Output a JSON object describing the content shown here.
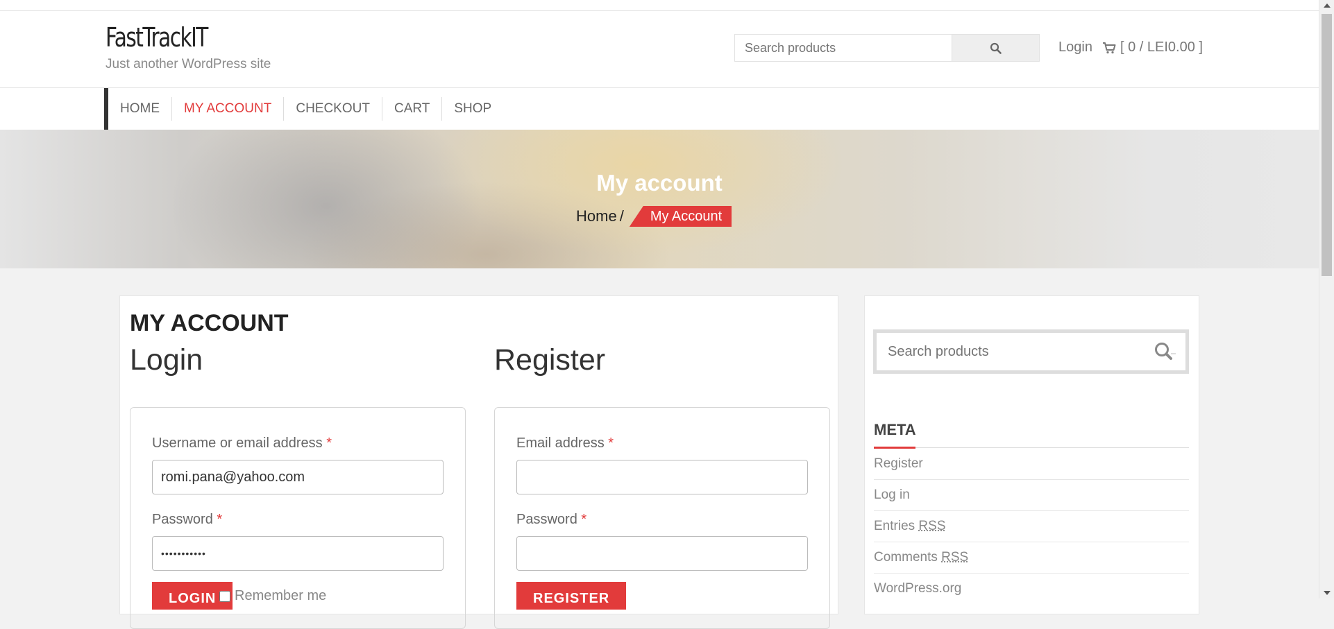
{
  "site": {
    "title": "FastTrackIT",
    "description": "Just another WordPress site"
  },
  "header": {
    "search_placeholder": "Search products",
    "login_label": "Login",
    "cart_label": "[ 0 / LEI0.00 ]"
  },
  "nav": {
    "items": [
      {
        "label": "HOME",
        "active": false
      },
      {
        "label": "MY ACCOUNT",
        "active": true
      },
      {
        "label": "CHECKOUT",
        "active": false
      },
      {
        "label": "CART",
        "active": false
      },
      {
        "label": "SHOP",
        "active": false
      }
    ]
  },
  "banner": {
    "title": "My account",
    "breadcrumb_home": "Home",
    "breadcrumb_separator": "/",
    "breadcrumb_current": "My Account"
  },
  "main": {
    "page_title": "MY ACCOUNT",
    "login": {
      "heading": "Login",
      "username_label": "Username or email address",
      "username_value": "romi.pana@yahoo.com",
      "password_label": "Password",
      "password_value": "•••••••••••",
      "required_marker": "*",
      "button_label": "LOGIN",
      "remember_label": "Remember me"
    },
    "register": {
      "heading": "Register",
      "email_label": "Email address",
      "email_value": "",
      "password_label": "Password",
      "password_value": "",
      "required_marker": "*",
      "button_label": "REGISTER"
    }
  },
  "sidebar": {
    "search_placeholder": "Search products",
    "meta_title": "META",
    "meta_links": [
      {
        "label": "Register"
      },
      {
        "label": "Log in"
      },
      {
        "label": "Entries",
        "abbr": "RSS"
      },
      {
        "label": "Comments",
        "abbr": "RSS"
      },
      {
        "label": "WordPress.org"
      }
    ]
  },
  "colors": {
    "accent": "#e23b3b",
    "nav_bar": "#333333"
  },
  "icons": {
    "header_search": "search-icon",
    "cart": "cart-icon",
    "sidebar_search": "search-icon"
  }
}
